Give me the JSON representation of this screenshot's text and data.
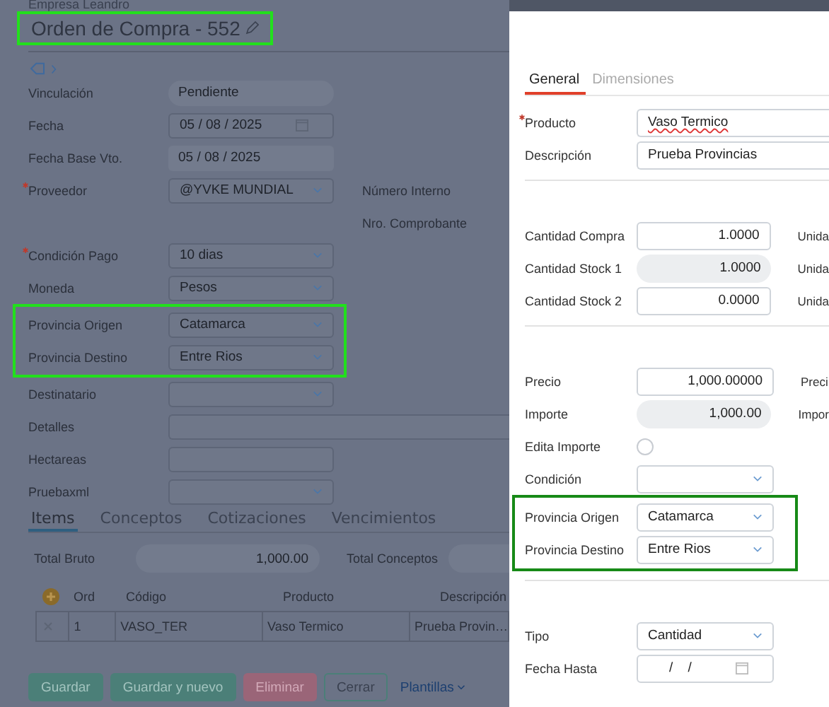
{
  "company": "Empresa Leandro",
  "title": {
    "text": "Orden de Compra - 552",
    "highlighted": true
  },
  "form": {
    "rows": [
      {
        "kind": "pill",
        "label": "Vinculación",
        "value": "Pendiente"
      },
      {
        "kind": "date",
        "label": "Fecha",
        "value": "05 / 08 / 2025"
      },
      {
        "kind": "readonly",
        "label": "Fecha Base Vto.",
        "value": "05 / 08 / 2025"
      },
      {
        "kind": "select",
        "label": "Proveedor",
        "required": true,
        "value": "@YVKE MUNDIAL",
        "side_label": "Número Interno"
      },
      {
        "kind": "none",
        "side_label": "Nro. Comprobante"
      },
      {
        "kind": "select",
        "label": "Condición Pago",
        "required": true,
        "value": "10 dias"
      },
      {
        "kind": "select",
        "label": "Moneda",
        "value": "Pesos"
      },
      {
        "kind": "group",
        "highlighted": true,
        "rows": [
          {
            "kind": "select",
            "label": "Provincia Origen",
            "value": "Catamarca"
          },
          {
            "kind": "select",
            "label": "Provincia Destino",
            "value": "Entre Rios"
          }
        ]
      },
      {
        "kind": "select",
        "label": "Destinatario"
      },
      {
        "kind": "wide",
        "label": "Detalles"
      },
      {
        "kind": "text",
        "label": "Hectareas"
      },
      {
        "kind": "select",
        "label": "Pruebaxml"
      }
    ]
  },
  "tabs": [
    {
      "label": "Items",
      "selected": true
    },
    {
      "label": "Conceptos",
      "selected": false
    },
    {
      "label": "Cotizaciones",
      "selected": false
    },
    {
      "label": "Vencimientos",
      "selected": false
    }
  ],
  "totals": [
    {
      "label": "Total Bruto",
      "value": "1,000.00"
    },
    {
      "label": "Total Conceptos"
    }
  ],
  "table": {
    "columns": [
      "Ord",
      "Código",
      "Producto",
      "Descripción"
    ],
    "rows": [
      [
        "1",
        "VASO_TER",
        "Vaso Termico",
        "Prueba Provin…"
      ]
    ]
  },
  "buttons": [
    {
      "kind": "primary",
      "label": "Guardar"
    },
    {
      "kind": "primary",
      "label": "Guardar y nuevo"
    },
    {
      "kind": "danger",
      "label": "Eliminar"
    },
    {
      "kind": "outline",
      "label": "Cerrar"
    },
    {
      "kind": "link",
      "label": "Plantillas"
    }
  ],
  "detail": {
    "tabs": [
      {
        "label": "General",
        "selected": true
      },
      {
        "label": "Dimensiones",
        "selected": false
      }
    ],
    "sections": [
      [
        {
          "kind": "wide",
          "label": "Producto",
          "required": true,
          "value": "Vaso Termico",
          "misspelled": true
        },
        {
          "kind": "wide",
          "label": "Descripción",
          "value": "Prueba Provincias"
        }
      ],
      [
        {
          "kind": "number",
          "label": "Cantidad Compra",
          "value": "1.0000",
          "side_label": "Unida"
        },
        {
          "kind": "readonly",
          "label": "Cantidad Stock 1",
          "value": "1.0000",
          "side_label": "Unida"
        },
        {
          "kind": "number",
          "label": "Cantidad Stock 2",
          "value": "0.0000",
          "side_label": "Unida"
        }
      ],
      [
        {
          "kind": "number",
          "label": "Precio",
          "value": "1,000.00000",
          "side_label": "Preci"
        },
        {
          "kind": "readonly",
          "label": "Importe",
          "value": "1,000.00",
          "side_label": "Impor"
        },
        {
          "kind": "radio",
          "label": "Edita Importe",
          "checked": false
        },
        {
          "kind": "select",
          "label": "Condición"
        },
        {
          "kind": "group",
          "highlighted": true,
          "rows": [
            {
              "kind": "select",
              "label": "Provincia Origen",
              "value": "Catamarca"
            },
            {
              "kind": "select",
              "label": "Provincia Destino",
              "value": "Entre Rios"
            }
          ]
        }
      ],
      [
        {
          "kind": "select",
          "label": "Tipo",
          "value": "Cantidad"
        },
        {
          "kind": "date",
          "label": "Fecha Hasta",
          "value": "/    /"
        }
      ]
    ]
  }
}
